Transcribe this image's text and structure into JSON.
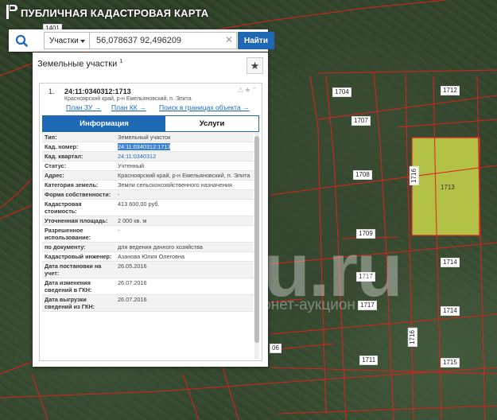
{
  "app": {
    "title": "ПУБЛИЧНАЯ КАДАСТРОВАЯ КАРТА"
  },
  "search": {
    "type_label": "Участки",
    "query": "56,078637 92,496209",
    "find_label": "Найти"
  },
  "panel": {
    "title": "Земельные участки",
    "title_sup": "1",
    "card": {
      "number": "1.",
      "cadnum": "24:11:0340312:1713",
      "address": "Красноярский край, р-н Емельяновский, п. Элита",
      "links": [
        "План ЗУ →",
        "План КК →",
        "Поиск в границах объекта →"
      ],
      "tabs": [
        "Информация",
        "Услуги"
      ]
    },
    "rows": [
      {
        "k": "Тип:",
        "v": "Земельный участок"
      },
      {
        "k": "Кад. номер:",
        "v": "24:11:0340312:1713"
      },
      {
        "k": "Кад. квартал:",
        "v": "24:11:0340312"
      },
      {
        "k": "Статус:",
        "v": "Учтенный"
      },
      {
        "k": "Адрес:",
        "v": "Красноярский край, р-н Емельяновский, п. Элита"
      },
      {
        "k": "Категория земель:",
        "v": "Земли сельскохозяйственного назначения"
      },
      {
        "k": "Форма собственности:",
        "v": "-"
      },
      {
        "k": "Кадастровая стоимость:",
        "v": "413 600,00 руб."
      },
      {
        "k": "Уточненная площадь:",
        "v": "2 000 кв. м"
      },
      {
        "k": "Разрешенное использование:",
        "v": "-"
      },
      {
        "k": "по документу:",
        "v": "для ведения дачного хозяйства"
      },
      {
        "k": "Кадастровый инженер:",
        "v": "Азанова Юлия Олеговна"
      },
      {
        "k": "Дата постановки на учет:",
        "v": "26.05.2016"
      },
      {
        "k": "Дата изменения сведений в ГКН:",
        "v": "26.07.2016"
      },
      {
        "k": "Дата выгрузки сведений из ГКН:",
        "v": "26.07.2016"
      }
    ]
  },
  "map": {
    "parcels": [
      "1401",
      "1704",
      "1712",
      "1707",
      "1708",
      "1716",
      "1713",
      "1709",
      "1714",
      "1717",
      "1717",
      "1714",
      "1716",
      "1711",
      "1715",
      "06"
    ]
  },
  "watermark": {
    "main": "au.ru",
    "sub": "интернет-аукцион"
  },
  "colors": {
    "accent": "#1f68b5",
    "selected_parcel": "#c8d64a",
    "boundary": "#e02020"
  }
}
